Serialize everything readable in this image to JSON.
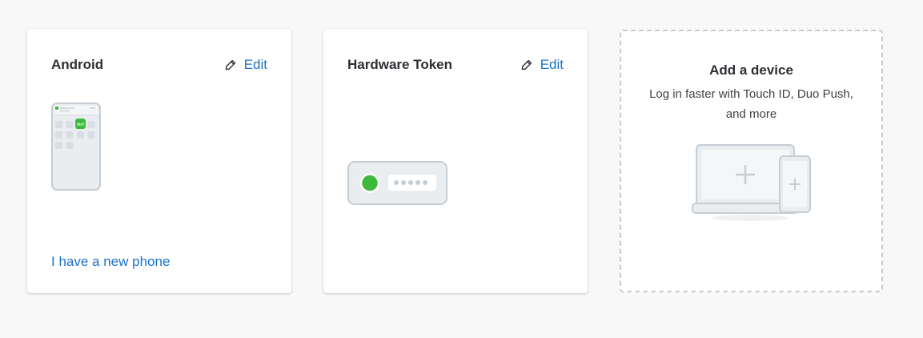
{
  "devices": [
    {
      "title": "Android",
      "edit_label": "Edit",
      "action_label": "I have a new phone",
      "app_badge": "DUO"
    },
    {
      "title": "Hardware Token",
      "edit_label": "Edit"
    }
  ],
  "add_device": {
    "title": "Add a device",
    "description": "Log in faster with Touch ID, Duo Push, and more"
  },
  "colors": {
    "link": "#1a73c8",
    "brand_green": "#3fb93d",
    "illustration_stroke": "#c6cdd3",
    "illustration_fill": "#e9edf0"
  },
  "icons": {
    "edit": "pencil-icon",
    "phone": "phone-illustration-icon",
    "token": "hardware-token-icon",
    "add": "add-devices-icon"
  }
}
